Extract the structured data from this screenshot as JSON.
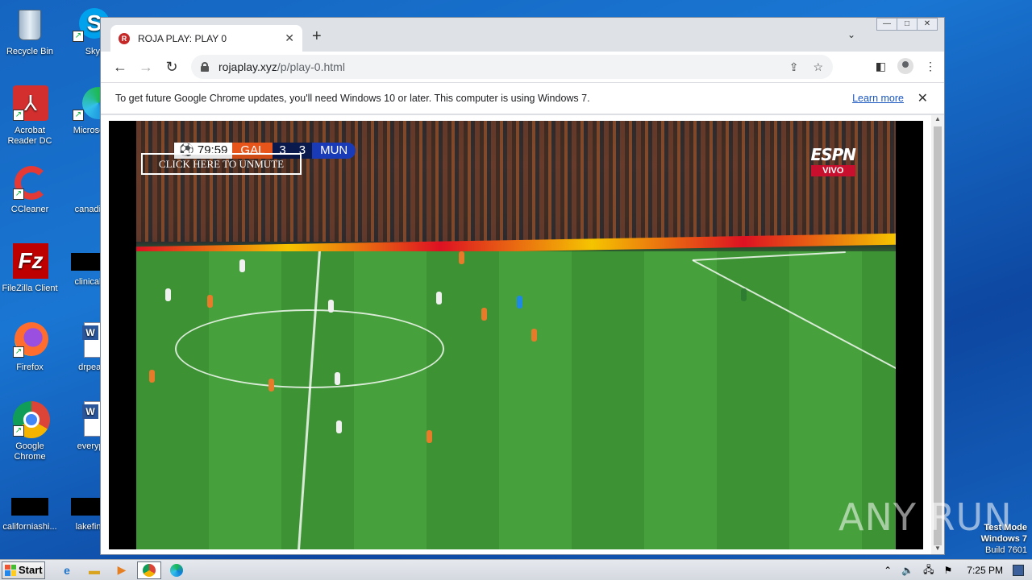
{
  "desktop": {
    "icons": [
      {
        "label": "Recycle Bin",
        "icon": "recycle-bin-icon"
      },
      {
        "label": "Skype",
        "icon": "skype-icon"
      },
      {
        "label": "Acrobat Reader DC",
        "icon": "acrobat-icon"
      },
      {
        "label": "Microsoft",
        "icon": "edge-icon"
      },
      {
        "label": "CCleaner",
        "icon": "ccleaner-icon"
      },
      {
        "label": "canadian",
        "icon": "blank-file-icon"
      },
      {
        "label": "FileZilla Client",
        "icon": "filezilla-icon"
      },
      {
        "label": "clinicaljac",
        "icon": "blank-file-icon"
      },
      {
        "label": "Firefox",
        "icon": "firefox-icon"
      },
      {
        "label": "drpeace",
        "icon": "word-doc-icon"
      },
      {
        "label": "Google Chrome",
        "icon": "chrome-icon"
      },
      {
        "label": "everypre",
        "icon": "word-doc-icon"
      },
      {
        "label": "californiashi...",
        "icon": "blank-file-icon"
      },
      {
        "label": "lakefinall",
        "icon": "blank-file-icon"
      }
    ]
  },
  "browser": {
    "tab_title": "ROJA PLAY: PLAY 0",
    "url_host": "rojaplay.xyz",
    "url_path": "/p/play-0.html",
    "infobar_text": "To get future Google Chrome updates, you'll need Windows 10 or later. This computer is using Windows 7.",
    "infobar_link": "Learn more"
  },
  "video": {
    "clock": "79:59",
    "team_home": "GAL",
    "score_home": "3",
    "score_away": "3",
    "team_away": "MUN",
    "unmute_label": "CLICK HERE TO UNMUTE",
    "broadcaster": "ESPN",
    "live_label": "VIVO"
  },
  "watermark": {
    "text": "ANY RUN",
    "test_mode": "Test Mode",
    "os": "Windows 7",
    "build": "Build 7601"
  },
  "taskbar": {
    "start_label": "Start",
    "clock": "7:25 PM"
  }
}
